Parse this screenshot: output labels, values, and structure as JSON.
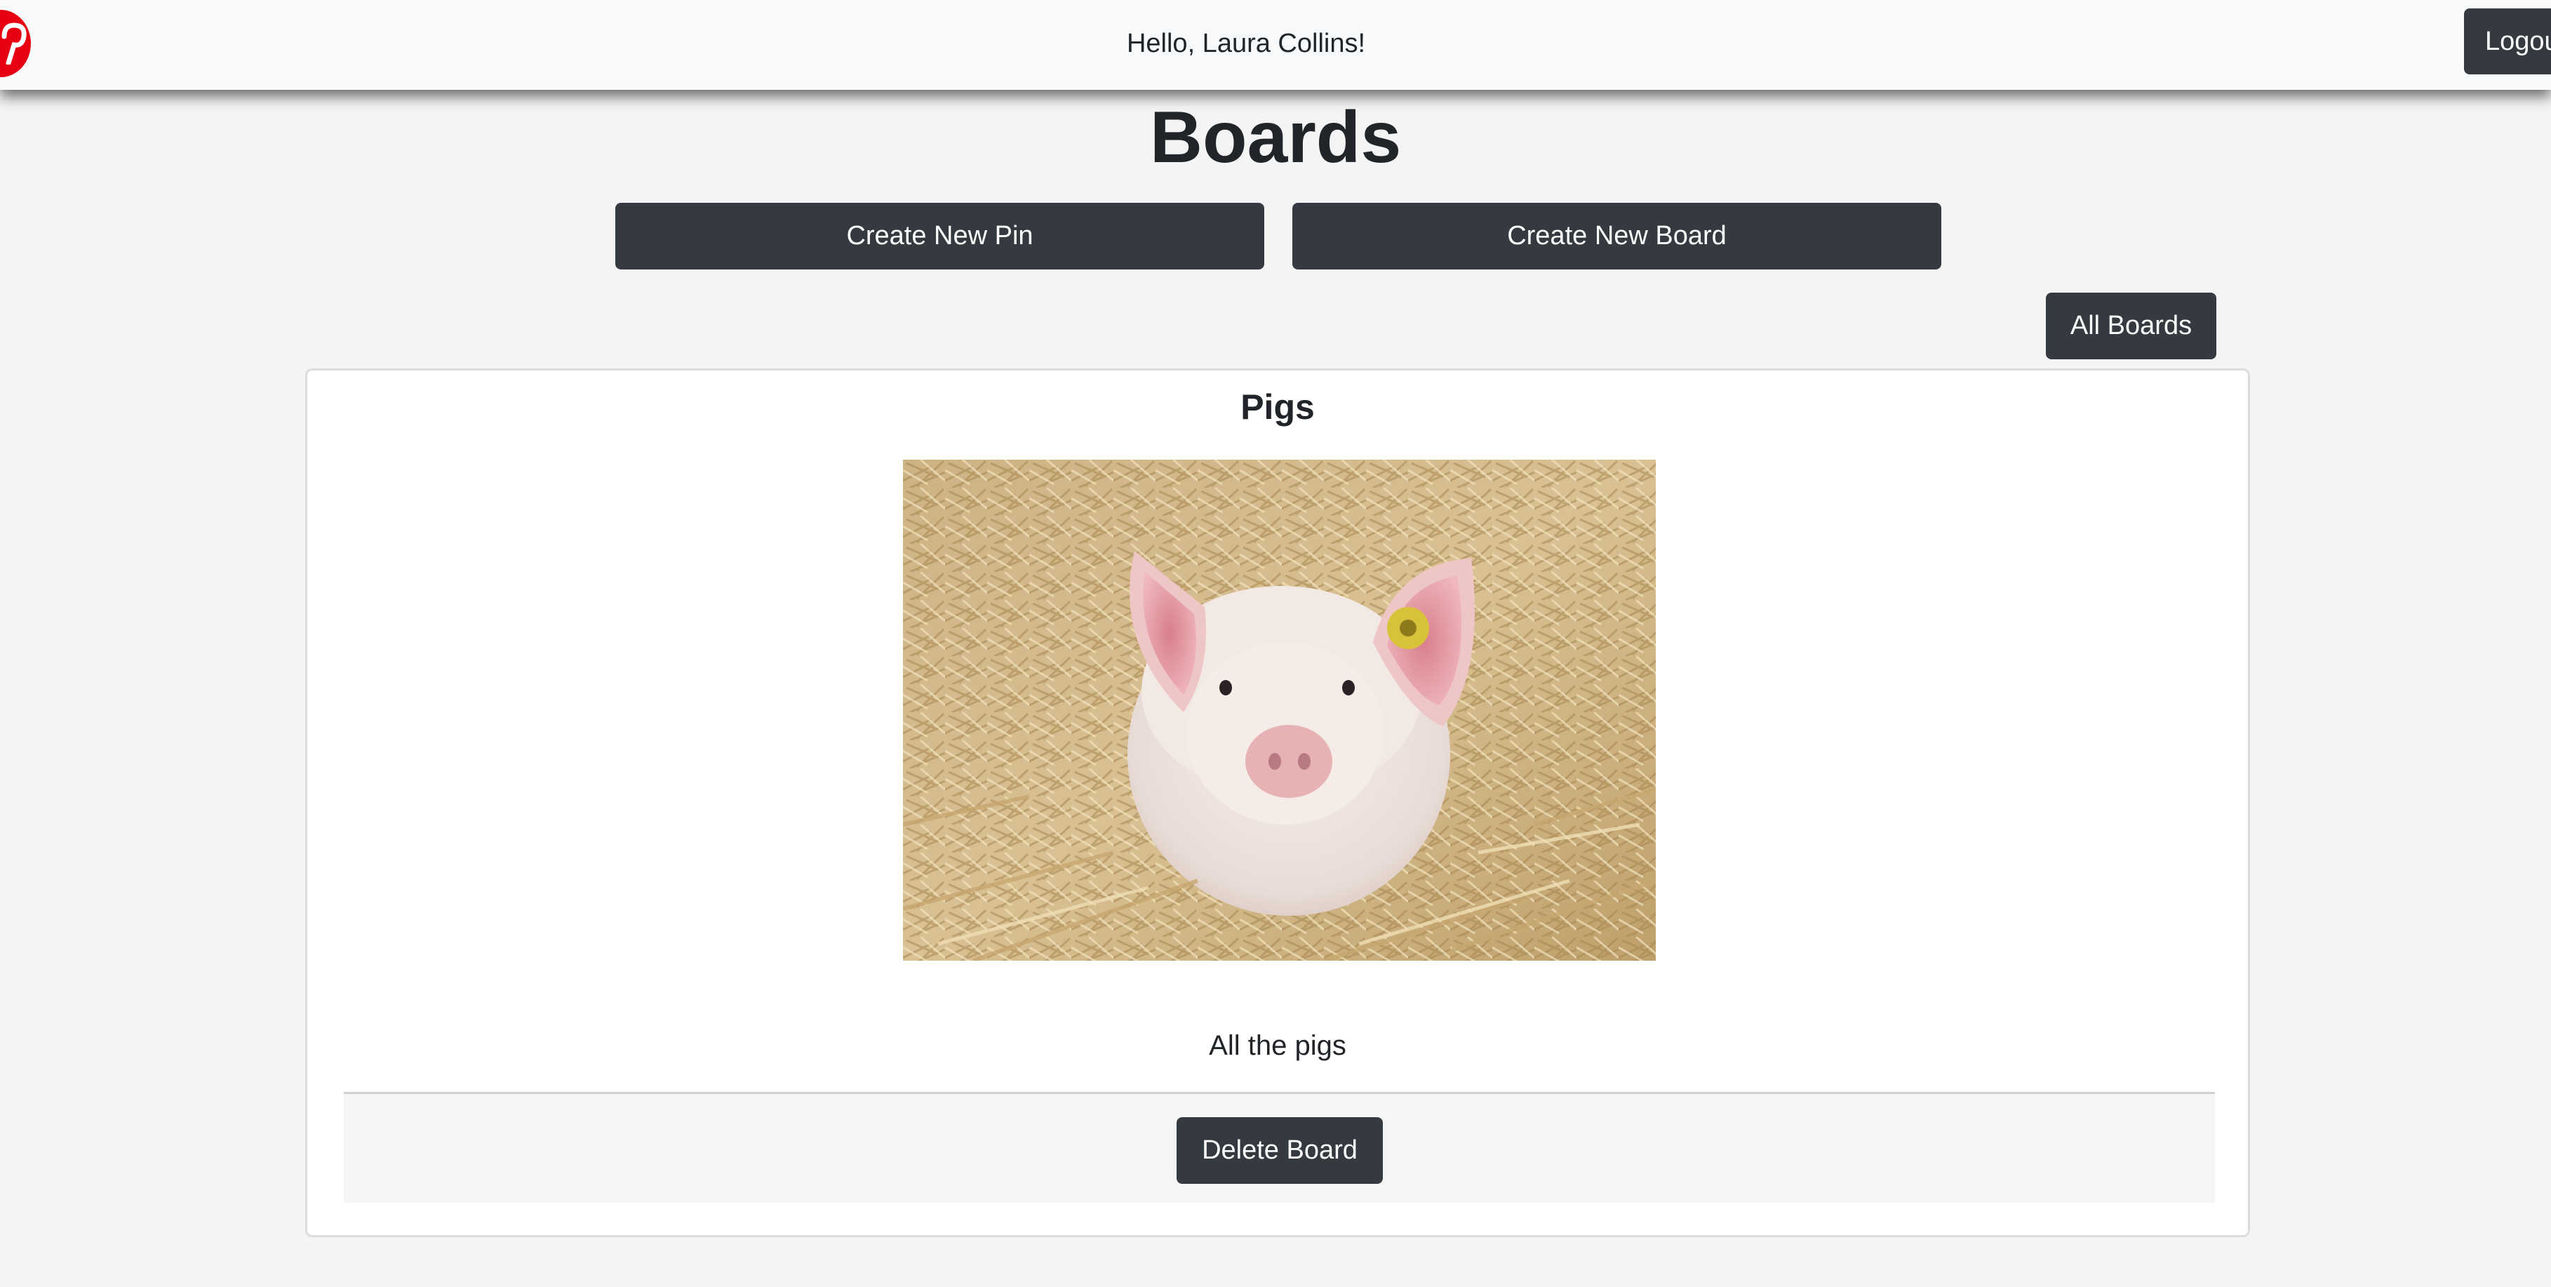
{
  "navbar": {
    "greeting": "Hello, Laura Collins!",
    "logout_label": "Logout",
    "logo_icon": "pinterest-logo-icon",
    "brand_color": "#e60012"
  },
  "page": {
    "title": "Boards"
  },
  "actions": {
    "create_pin_label": "Create New Pin",
    "create_board_label": "Create New Board",
    "all_boards_label": "All Boards"
  },
  "board": {
    "name": "Pigs",
    "image_alt": "Pigs",
    "description": "All the pigs",
    "delete_label": "Delete Board"
  },
  "colors": {
    "button_dark": "#343a40",
    "background": "#f4f4f4",
    "navbar_bg": "#f8f9fa"
  }
}
